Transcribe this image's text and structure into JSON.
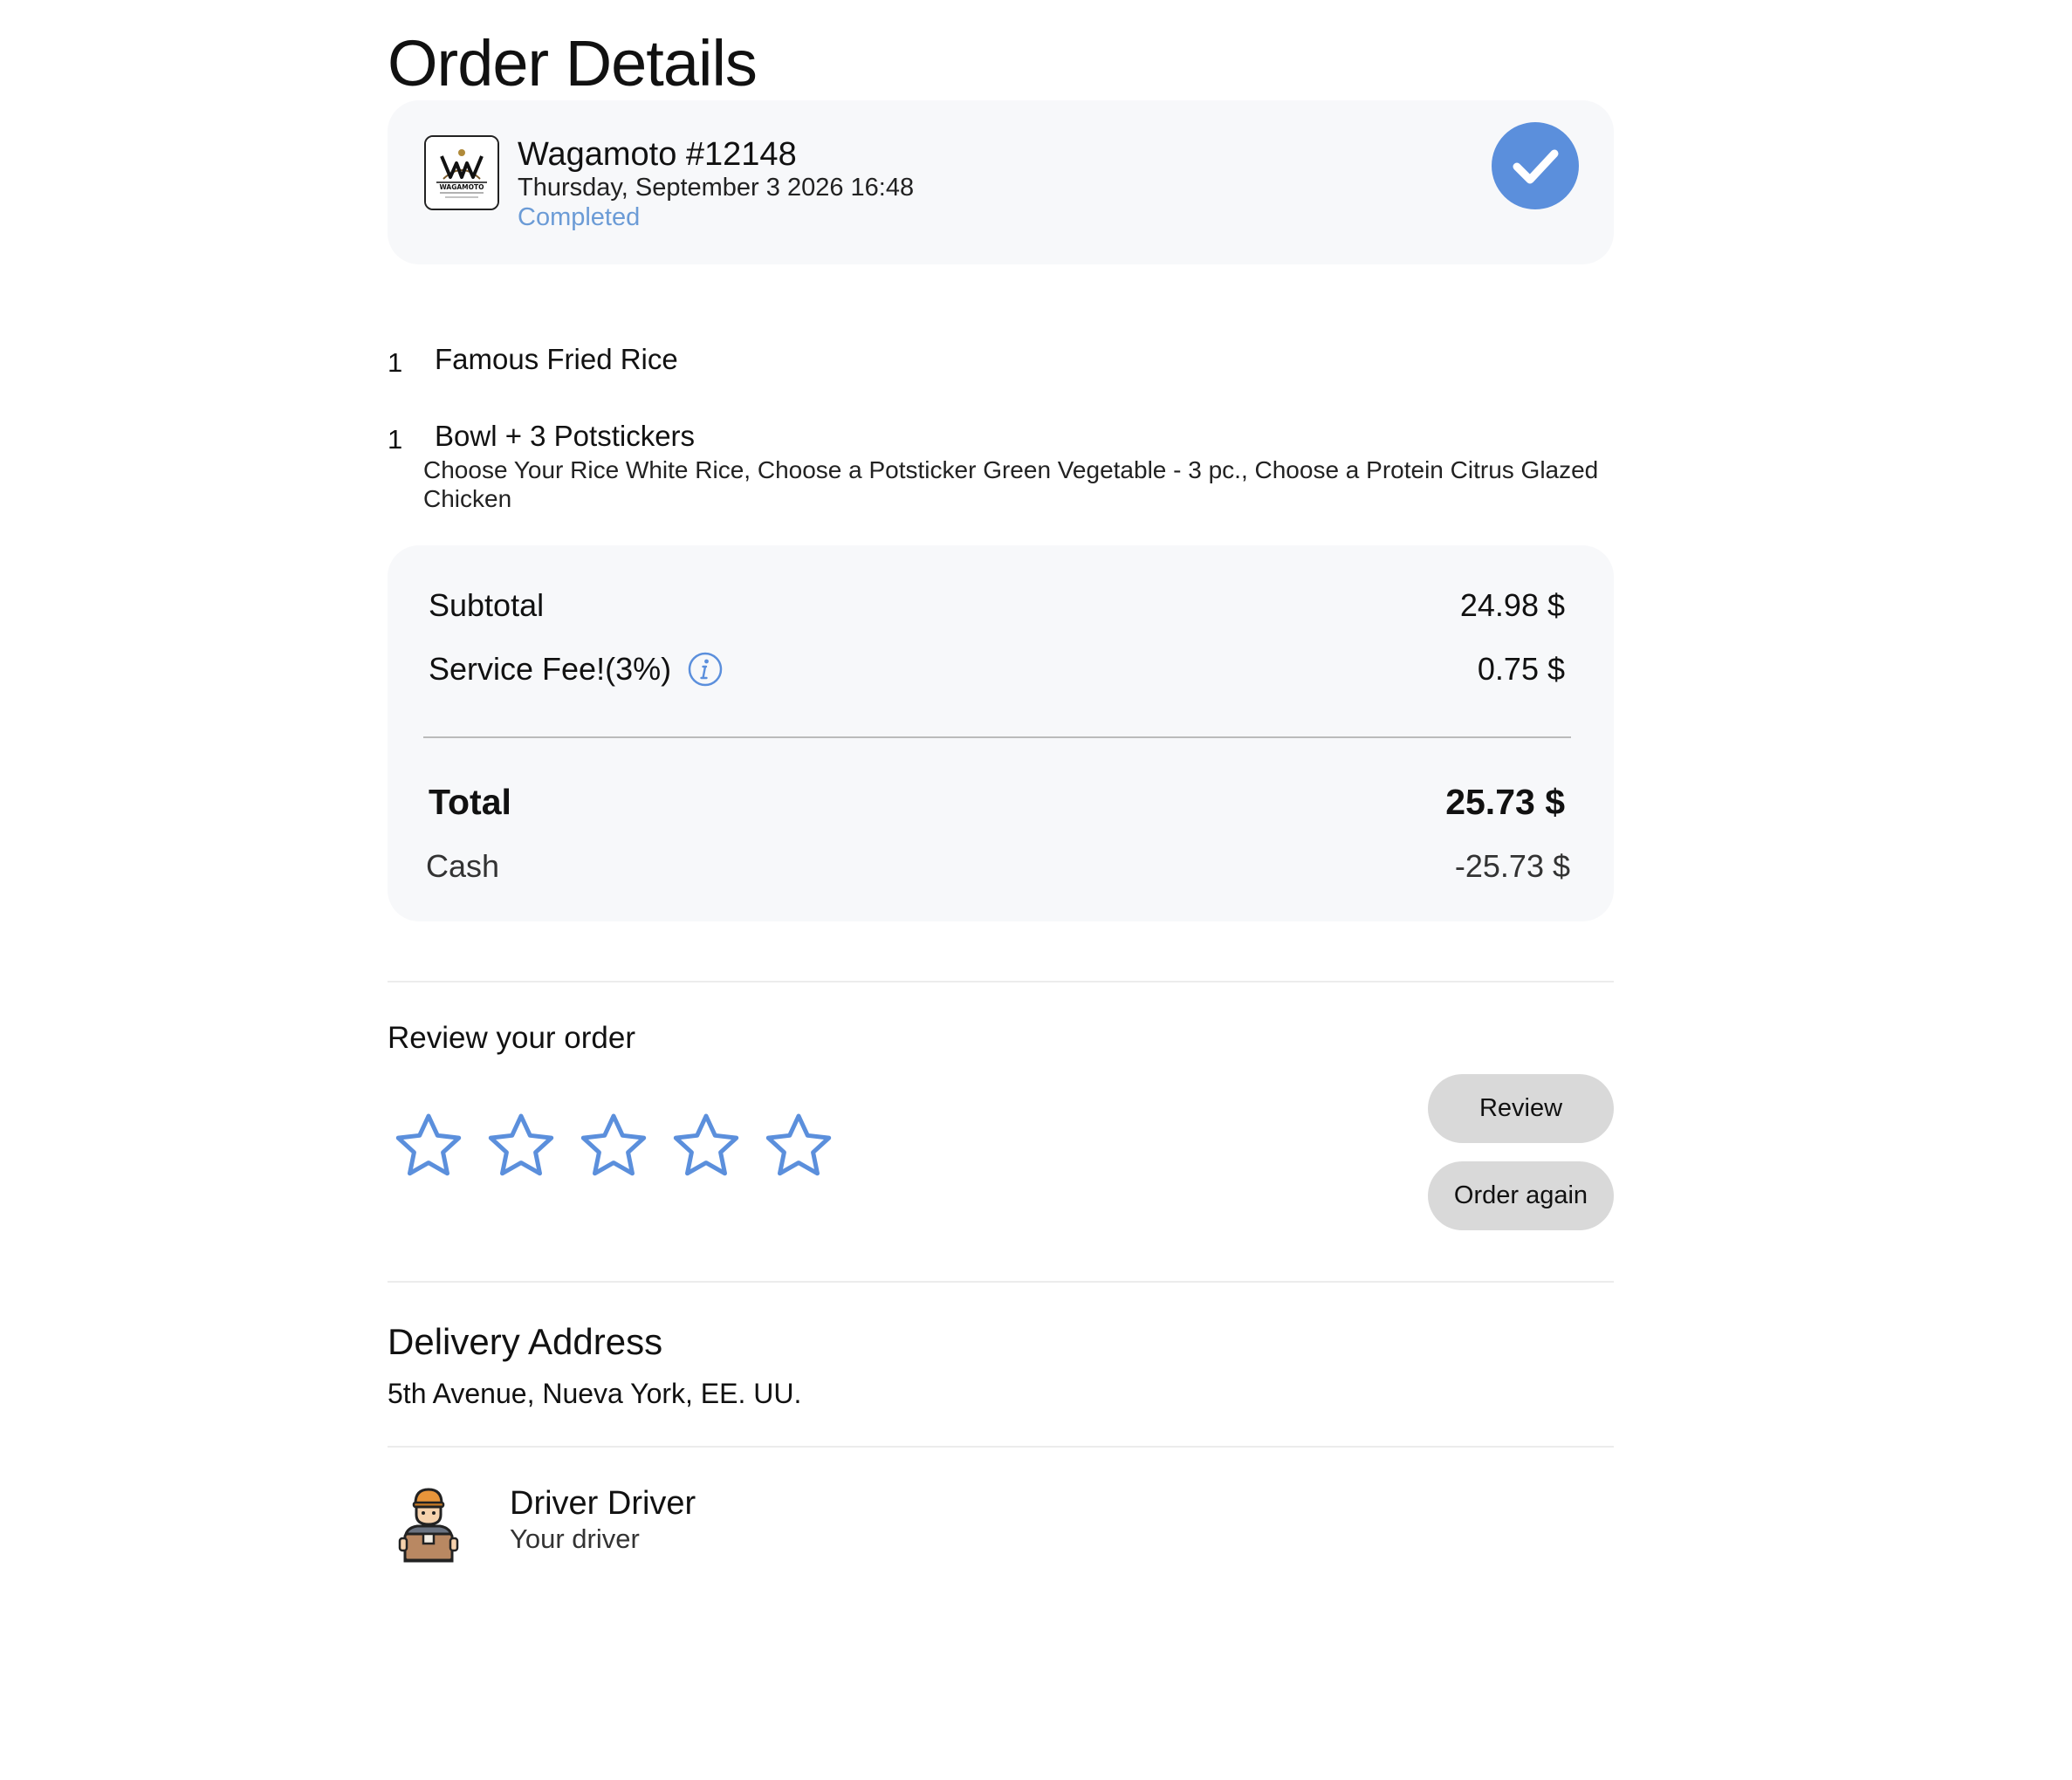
{
  "page": {
    "title": "Order Details"
  },
  "order": {
    "restaurant": "Wagamoto #12148",
    "date": "Thursday, September 3 2026 16:48",
    "status": "Completed",
    "logo_text": "WAGAMOTO"
  },
  "items": [
    {
      "qty": "1",
      "name": "Famous Fried Rice",
      "options": ""
    },
    {
      "qty": "1",
      "name": "Bowl + 3 Potstickers",
      "options": "Choose Your Rice White Rice, Choose a Potsticker Green Vegetable - 3 pc., Choose a Protein Citrus Glazed Chicken"
    }
  ],
  "totals": {
    "subtotal_label": "Subtotal",
    "subtotal_value": "24.98 $",
    "fee_label": "Service Fee!(3%)",
    "fee_value": "0.75 $",
    "total_label": "Total",
    "total_value": "25.73 $",
    "cash_label": "Cash",
    "cash_value": "-25.73 $"
  },
  "review": {
    "title": "Review your order",
    "rating": 0,
    "max_rating": 5,
    "review_button": "Review",
    "order_again_button": "Order again"
  },
  "delivery": {
    "title": "Delivery Address",
    "address": "5th Avenue, Nueva York, EE. UU."
  },
  "driver": {
    "name": "Driver Driver",
    "role": "Your driver"
  },
  "colors": {
    "accent": "#5b8fdc",
    "status": "#6b9bd6",
    "card_bg": "#f7f8fa",
    "button_bg": "#d9d9d9"
  },
  "icons": {
    "status": "check-circle-icon",
    "info": "info-icon",
    "star": "star-outline-icon",
    "driver": "delivery-driver-icon"
  }
}
